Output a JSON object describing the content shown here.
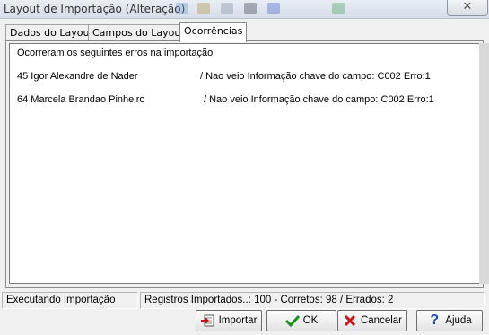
{
  "window": {
    "title": "Layout de Importação (Alteração)",
    "close_symbol": "✕"
  },
  "tabs": [
    {
      "label": "Dados do Layout",
      "active": false
    },
    {
      "label": "Campos do Layout",
      "active": false
    },
    {
      "label": "Ocorrências",
      "active": true
    }
  ],
  "memo": {
    "header": "Ocorreram os seguintes erros na importação",
    "errors": [
      {
        "record": "45 Igor Alexandre de Nader",
        "message": "/ Nao veio Informação chave do campo: C002 Erro:1"
      },
      {
        "record": "64 Marcela Brandao Pinheiro",
        "message": "/ Nao veio Informação chave do campo: C002 Erro:1"
      }
    ]
  },
  "status": {
    "left": "Executando Importação",
    "right": "Registros Importados..: 100 - Corretos: 98 / Errados: 2"
  },
  "buttons": {
    "importar": {
      "label": "Importar",
      "icon": "import-icon"
    },
    "ok": {
      "label": "OK",
      "icon": "check-icon"
    },
    "cancelar": {
      "label": "Cancelar",
      "icon": "cross-icon"
    },
    "ajuda": {
      "label": "Ajuda",
      "icon": "help-icon"
    }
  },
  "colors": {
    "ok": "#1a8f1a",
    "cancel": "#c81414",
    "help": "#1f4fbf"
  }
}
